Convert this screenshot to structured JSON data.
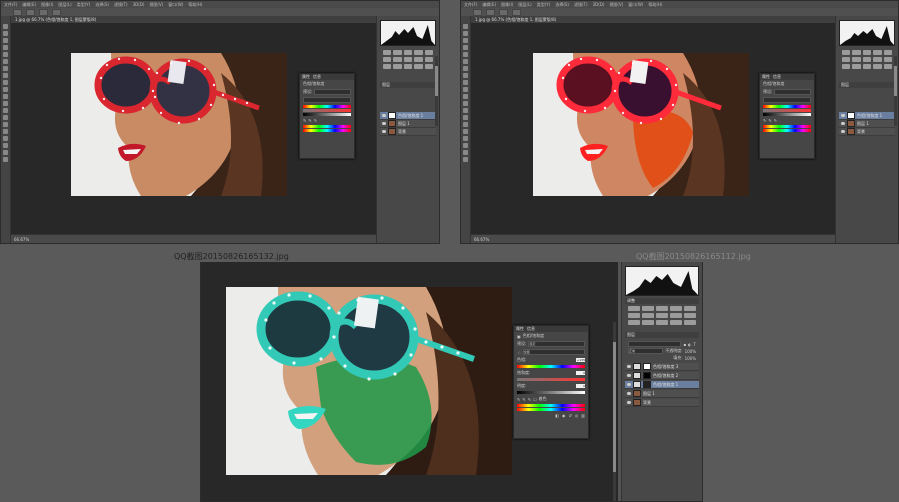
{
  "captions": {
    "left": "QQ截图20150826165132.jpg",
    "right": "QQ截图20150826165112.jpg"
  },
  "colors": {
    "desktop": "#5a5a5a",
    "ps_bg": "#535353",
    "canvas": "#282828",
    "glasses_red": "#d9262f",
    "glasses_teal": "#33c9b7",
    "tint_orange": "#e24a10",
    "tint_green": "#1e9a4a"
  },
  "ps": {
    "menu_items": [
      "文件(F)",
      "编辑(E)",
      "图像(I)",
      "图层(L)",
      "类型(Y)",
      "选择(S)",
      "滤镜(T)",
      "3D(D)",
      "视图(V)",
      "窗口(W)",
      "帮助(H)"
    ],
    "doc_tab": "1.jpg @ 66.7% (色相/饱和度 1, 图层蒙版/8)",
    "status_zoom": "66.67%",
    "histogram_tab": "直方图",
    "adjust_tab": "调整",
    "layers_tab": "图层",
    "layers_bottom": {
      "blend_mode": "正常",
      "opacity_label": "不透明度:",
      "opacity": "100%",
      "fill_label": "填充:",
      "fill": "100%",
      "rows": [
        {
          "name": "色相/饱和度 3"
        },
        {
          "name": "色相/饱和度 2"
        },
        {
          "name": "色相/饱和度 1"
        },
        {
          "name": "图层 1"
        },
        {
          "name": "背景"
        }
      ]
    },
    "layers_top": {
      "rows": [
        {
          "name": "色相/饱和度 1"
        },
        {
          "name": "图层 1"
        },
        {
          "name": "背景"
        }
      ]
    },
    "props": {
      "tab1": "属性",
      "tab2": "信息",
      "title": "色相/饱和度",
      "preset_label": "预设:",
      "preset_value": "自定",
      "channel_value": "全图",
      "hue_label": "色相:",
      "hue_value": "+135",
      "sat_label": "饱和度:",
      "sat_value": "0",
      "light_label": "明度:",
      "light_value": "0",
      "colorize_label": "着色"
    }
  }
}
